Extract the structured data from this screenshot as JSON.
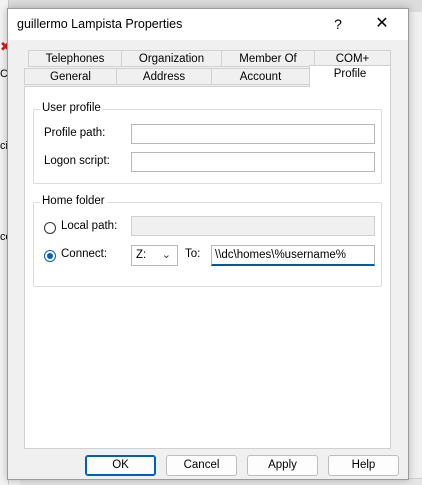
{
  "background": {
    "fragments": [
      "Co",
      "ci",
      "co"
    ]
  },
  "dialog": {
    "title": "guillermo Lampista Properties",
    "help_glyph": "?",
    "close_glyph": "✕"
  },
  "tabs": {
    "row1": [
      "Telephones",
      "Organization",
      "Member Of",
      "COM+"
    ],
    "row2": [
      "General",
      "Address",
      "Account",
      "Profile"
    ],
    "active": "Profile"
  },
  "user_profile": {
    "group_label": "User profile",
    "profile_path_label": "Profile path:",
    "profile_path_value": "",
    "logon_script_label": "Logon script:",
    "logon_script_value": ""
  },
  "home_folder": {
    "group_label": "Home folder",
    "local_path_label": "Local path:",
    "local_path_value": "",
    "connect_label": "Connect:",
    "drive_value": "Z:",
    "to_label": "To:",
    "to_value": "\\\\dc\\homes\\%username%"
  },
  "buttons": {
    "ok": "OK",
    "cancel": "Cancel",
    "apply": "Apply",
    "help": "Help"
  }
}
